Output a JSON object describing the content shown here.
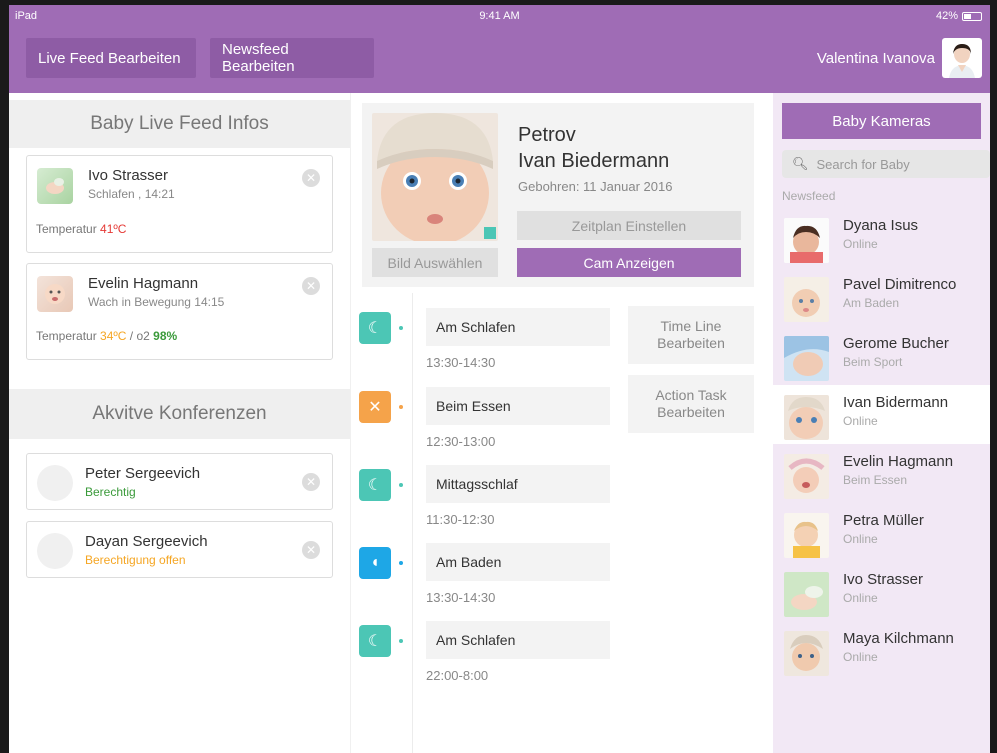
{
  "status_bar": {
    "device": "iPad",
    "time": "9:41 AM",
    "battery": "42%"
  },
  "header": {
    "live_feed_button": "Live Feed Bearbeiten",
    "newsfeed_button": "Newsfeed Bearbeiten",
    "user_name": "Valentina Ivanova",
    "brand_color": "#9f6cb5"
  },
  "live_feed": {
    "title": "Baby Live Feed Infos",
    "cards": [
      {
        "name": "Ivo Strasser",
        "status": "Schlafen , 14:21",
        "temp_label": "Temperatur",
        "temp_value": "41ºC",
        "temp_color": "#e53935"
      },
      {
        "name": "Evelin Hagmann",
        "status": "Wach in Bewegung  14:15",
        "temp_label": "Temperatur",
        "temp_value": "34ºC",
        "temp_color": "#f5a623",
        "o2_label": " / o2 ",
        "o2_value": "98%",
        "o2_color": "#3a9a3a"
      }
    ]
  },
  "conferences": {
    "title": "Akvitve Konferenzen",
    "items": [
      {
        "name": "Peter Sergeevich",
        "status": "Berechtig",
        "status_color": "#3a9a3a"
      },
      {
        "name": "Dayan Sergeevich",
        "status": "Berechtigung offen",
        "status_color": "#f5a623"
      }
    ]
  },
  "profile": {
    "first": "Petrov",
    "name": "Ivan Biedermann",
    "born": "Gebohren: 11 Januar 2016",
    "schedule_button": "Zeitplan Einstellen",
    "choose_image_button": "Bild Auswählen",
    "cam_button": "Cam Anzeigen"
  },
  "timeline": [
    {
      "label": "Am Schlafen",
      "time": "13:30-14:30",
      "icon": "sleep-icon",
      "color": "#4cc6b5"
    },
    {
      "label": "Beim Essen",
      "time": "12:30-13:00",
      "icon": "fork-knife-icon",
      "color": "#f5a34a"
    },
    {
      "label": "Mittagsschlaf",
      "time": "11:30-12:30",
      "icon": "sleep-icon",
      "color": "#4cc6b5"
    },
    {
      "label": "Am Baden",
      "time": "13:30-14:30",
      "icon": "bath-icon",
      "color": "#1ea7e6"
    },
    {
      "label": "Am Schlafen",
      "time": "22:00-8:00",
      "icon": "sleep-icon",
      "color": "#4cc6b5"
    }
  ],
  "timeline_buttons": {
    "timeline_edit": [
      "Time Line",
      "Bearbeiten"
    ],
    "action_task_edit": [
      "Action Task",
      "Bearbeiten"
    ]
  },
  "cameras": {
    "button": "Baby Kameras",
    "search_placeholder": "Search for Baby",
    "section": "Newsfeed",
    "babies": [
      {
        "name": "Dyana Isus",
        "status": "Online",
        "selected": false
      },
      {
        "name": "Pavel Dimitrenco",
        "status": "Am Baden",
        "selected": false
      },
      {
        "name": "Gerome Bucher",
        "status": "Beim Sport",
        "selected": false
      },
      {
        "name": "Ivan Bidermann",
        "status": "Online",
        "selected": true
      },
      {
        "name": "Evelin Hagmann",
        "status": "Beim Essen",
        "selected": false
      },
      {
        "name": "Petra Müller",
        "status": "Online",
        "selected": false
      },
      {
        "name": "Ivo Strasser",
        "status": "Online",
        "selected": false
      },
      {
        "name": "Maya Kilchmann",
        "status": "Online",
        "selected": false
      }
    ]
  }
}
